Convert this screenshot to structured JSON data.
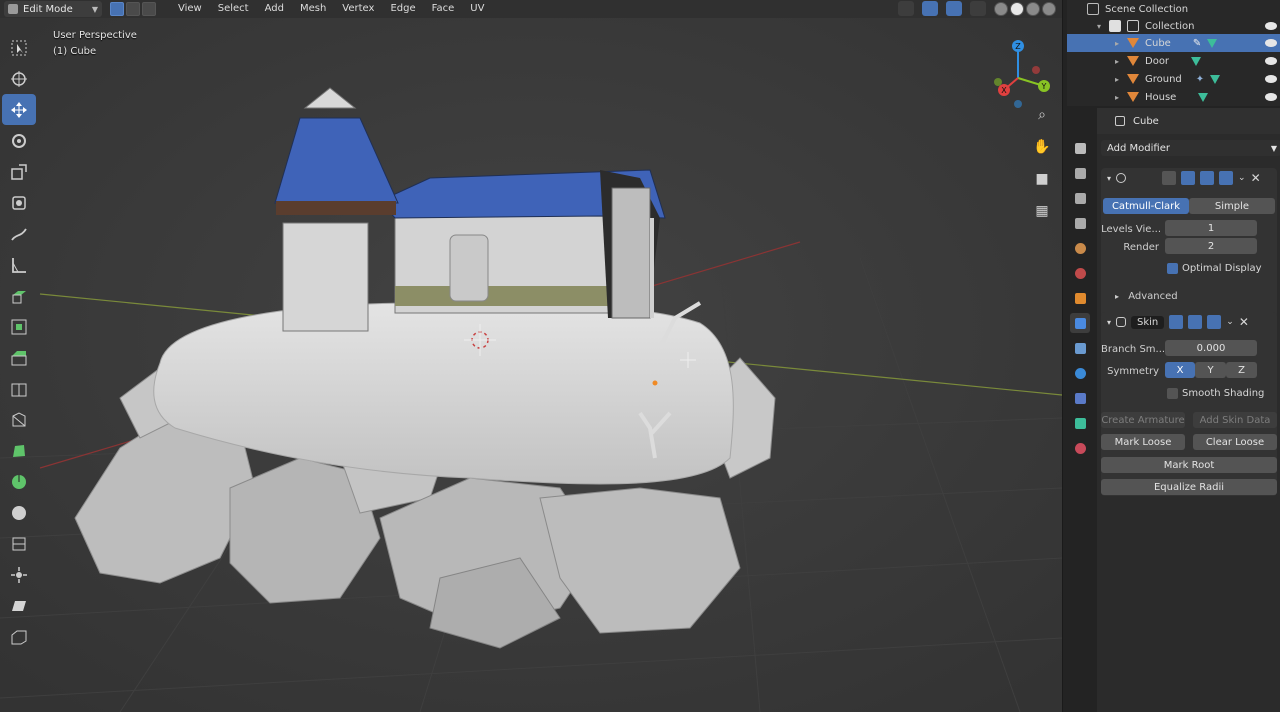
{
  "header": {
    "mode": "Edit Mode",
    "menus": [
      "View",
      "Select",
      "Add",
      "Mesh",
      "Vertex",
      "Edge",
      "Face",
      "UV"
    ]
  },
  "viewport": {
    "perspective": "User Perspective",
    "object": "(1) Cube"
  },
  "gizmo": {
    "z": "Z",
    "y": "Y",
    "x": "X"
  },
  "outliner": {
    "root": "Scene Collection",
    "collection": "Collection",
    "items": [
      {
        "name": "Cube",
        "selected": true
      },
      {
        "name": "Door",
        "selected": false
      },
      {
        "name": "Ground",
        "selected": false
      },
      {
        "name": "House",
        "selected": false
      }
    ]
  },
  "properties": {
    "object_name": "Cube",
    "add_modifier": "Add Modifier",
    "subsurf": {
      "tab_catmull": "Catmull-Clark",
      "tab_simple": "Simple",
      "levels_label": "Levels Vie...",
      "levels_value": "1",
      "render_label": "Render",
      "render_value": "2",
      "optimal_display": "Optimal Display",
      "advanced": "Advanced"
    },
    "skin": {
      "name": "Skin",
      "branch_label": "Branch Sm...",
      "branch_value": "0.000",
      "symmetry_label": "Symmetry",
      "sym_x": "X",
      "sym_y": "Y",
      "sym_z": "Z",
      "smooth_shading": "Smooth Shading",
      "create_armature": "Create Armature",
      "add_skin_data": "Add Skin Data",
      "mark_loose": "Mark Loose",
      "clear_loose": "Clear Loose",
      "mark_root": "Mark Root",
      "equalize_radii": "Equalize Radii"
    }
  },
  "colors": {
    "accent": "#4772b3",
    "roof": "#3f63b8",
    "axis_x": "#e0403f",
    "axis_y": "#88c424",
    "axis_z": "#2f8fe3"
  }
}
